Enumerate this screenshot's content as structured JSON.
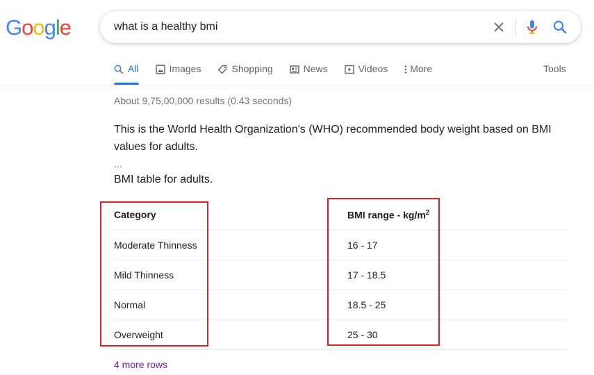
{
  "logo": {
    "letters": [
      "G",
      "o",
      "o",
      "g",
      "l",
      "e"
    ],
    "colors": [
      "#4285F4",
      "#EA4335",
      "#FBBC05",
      "#4285F4",
      "#34A853",
      "#EA4335"
    ]
  },
  "search": {
    "query": "what is a healthy bmi"
  },
  "tabs": [
    {
      "label": "All",
      "icon": "search-icon"
    },
    {
      "label": "Images",
      "icon": "image-icon"
    },
    {
      "label": "Shopping",
      "icon": "tag-icon"
    },
    {
      "label": "News",
      "icon": "news-icon"
    },
    {
      "label": "Videos",
      "icon": "play-icon"
    },
    {
      "label": "More",
      "icon": "kebab-icon"
    }
  ],
  "tools_label": "Tools",
  "result_stats": "About 9,75,00,000 results (0.43 seconds)",
  "snippet": {
    "text": "This is the World Health Organization's (WHO) recommended body weight based on BMI values for adults.",
    "ellipsis": "...",
    "caption": "BMI table for adults."
  },
  "table": {
    "header_category": "Category",
    "header_range": "BMI range - kg/m",
    "header_range_sup": "2",
    "rows": [
      {
        "category": "Moderate Thinness",
        "range": "16 - 17"
      },
      {
        "category": "Mild Thinness",
        "range": "17 - 18.5"
      },
      {
        "category": "Normal",
        "range": "18.5 - 25"
      },
      {
        "category": "Overweight",
        "range": "25 - 30"
      }
    ]
  },
  "more_rows_label": "4 more rows",
  "colors": {
    "accent": "#1a73e8",
    "highlight": "#e02020",
    "visited_link": "#681da8"
  }
}
